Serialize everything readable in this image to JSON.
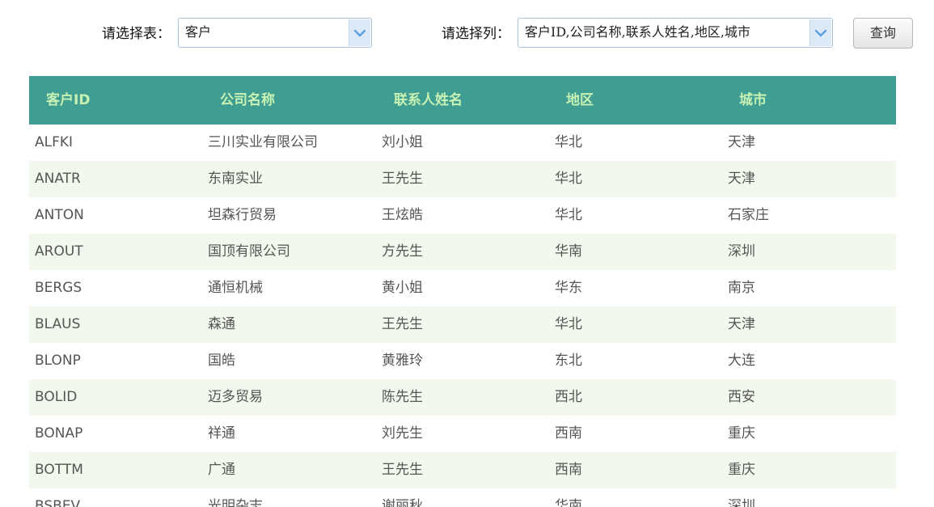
{
  "toolbar": {
    "table_label": "请选择表：",
    "table_value": "客户",
    "columns_label": "请选择列：",
    "columns_value": "客户ID,公司名称,联系人姓名,地区,城市",
    "query_button": "查询"
  },
  "colors": {
    "header_bg": "#3f9d91",
    "header_text": "#c8f2b4",
    "alt_row_bg": "#f2f8ee",
    "cell_text": "#555555",
    "dropdown_arrow": "#5aa0e0"
  },
  "icons": {
    "dropdown": "chevron-down-icon"
  },
  "table": {
    "headers": [
      "客户ID",
      "公司名称",
      "联系人姓名",
      "地区",
      "城市"
    ],
    "rows": [
      [
        "ALFKI",
        "三川实业有限公司",
        "刘小姐",
        "华北",
        "天津"
      ],
      [
        "ANATR",
        "东南实业",
        "王先生",
        "华北",
        "天津"
      ],
      [
        "ANTON",
        "坦森行贸易",
        "王炫皓",
        "华北",
        "石家庄"
      ],
      [
        "AROUT",
        "国顶有限公司",
        "方先生",
        "华南",
        "深圳"
      ],
      [
        "BERGS",
        "通恒机械",
        "黄小姐",
        "华东",
        "南京"
      ],
      [
        "BLAUS",
        "森通",
        "王先生",
        "华北",
        "天津"
      ],
      [
        "BLONP",
        "国皓",
        "黄雅玲",
        "东北",
        "大连"
      ],
      [
        "BOLID",
        "迈多贸易",
        "陈先生",
        "西北",
        "西安"
      ],
      [
        "BONAP",
        "祥通",
        "刘先生",
        "西南",
        "重庆"
      ],
      [
        "BOTTM",
        "广通",
        "王先生",
        "西南",
        "重庆"
      ],
      [
        "BSBEV",
        "光明杂志",
        "谢丽秋",
        "华南",
        "深圳"
      ]
    ]
  }
}
